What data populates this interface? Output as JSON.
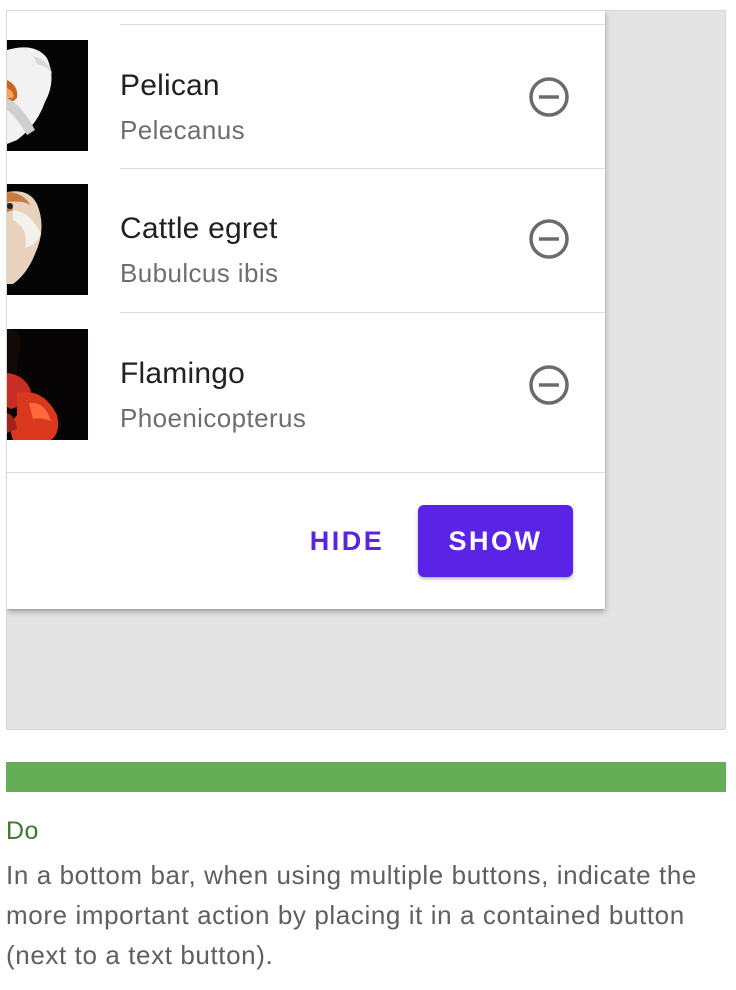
{
  "list": {
    "items": [
      {
        "title": "Pelican",
        "subtitle": "Pelecanus",
        "image": "pelican-image",
        "action_icon": "remove-circle-icon"
      },
      {
        "title": "Cattle egret",
        "subtitle": "Bubulcus ibis",
        "image": "cattle-egret-image",
        "action_icon": "remove-circle-icon"
      },
      {
        "title": "Flamingo",
        "subtitle": "Phoenicopterus",
        "image": "flamingo-image",
        "action_icon": "remove-circle-icon"
      }
    ]
  },
  "bottom_bar": {
    "hide_label": "HIDE",
    "show_label": "SHOW"
  },
  "caption": {
    "heading": "Do",
    "text": "In a bottom bar, when using multiple buttons, indicate the more important action by placing it in a contained button (next to a text button)."
  },
  "colors": {
    "primary": "#5b23e6",
    "do_bar": "#65ad57",
    "do_heading": "#3d7a2e",
    "stage_background": "#e4e4e4"
  }
}
